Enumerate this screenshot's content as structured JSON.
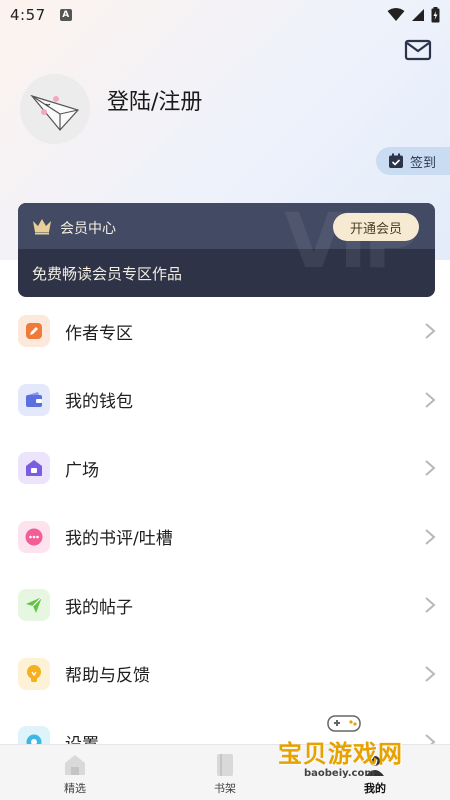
{
  "status_bar": {
    "time": "4:57",
    "notif": "A"
  },
  "profile": {
    "login_label": "登陆/注册"
  },
  "checkin": {
    "label": "签到"
  },
  "vip": {
    "center_label": "会员中心",
    "open_button": "开通会员",
    "subtitle": "免费畅读会员专区作品"
  },
  "menu": {
    "items": [
      {
        "label": "作者专区",
        "icon": "pencil-icon",
        "color": "#f07a3a",
        "bg": "#fde8dc"
      },
      {
        "label": "我的钱包",
        "icon": "wallet-icon",
        "color": "#5a6fe0",
        "bg": "#e4e8fb"
      },
      {
        "label": "广场",
        "icon": "home-icon",
        "color": "#7a5de0",
        "bg": "#ebe4fb"
      },
      {
        "label": "我的书评/吐槽",
        "icon": "chat-bubble-icon",
        "color": "#f25e95",
        "bg": "#fde3ee"
      },
      {
        "label": "我的帖子",
        "icon": "paper-plane-icon",
        "color": "#62c444",
        "bg": "#e6f6e0"
      },
      {
        "label": "帮助与反馈",
        "icon": "lightbulb-icon",
        "color": "#f5b01e",
        "bg": "#fdf2d6"
      },
      {
        "label": "设置",
        "icon": "gear-icon",
        "color": "#3cb8e6",
        "bg": "#dff3fb"
      }
    ]
  },
  "tabs": [
    {
      "label": "精选",
      "icon": "house-icon"
    },
    {
      "label": "书架",
      "icon": "book-icon"
    },
    {
      "label": "我的",
      "icon": "user-icon"
    }
  ],
  "watermark": {
    "text": "宝贝游戏网",
    "url": "baobeiy.com"
  }
}
